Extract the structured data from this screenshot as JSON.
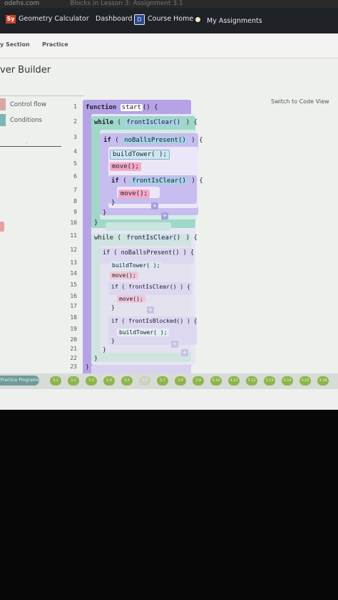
{
  "browser": {
    "domain": "odehs.com",
    "crumbs": "Blocks in Lesson 3: Assignment 3.1"
  },
  "header": {
    "brand_logo": "Sy",
    "brand": "Geometry Calculator",
    "nav": [
      "Dashboard",
      "Course Home",
      "My Assignments"
    ],
    "course_icon": "D"
  },
  "subnav": {
    "tabs": [
      "y Section",
      "Practice"
    ]
  },
  "page": {
    "title": "ver Builder",
    "switch_view": "Switch to Code View"
  },
  "palette": {
    "categories": [
      {
        "label": "Control flow",
        "color": "#d8a6a6"
      },
      {
        "label": "Conditions",
        "color": "#7fb6b4"
      }
    ],
    "dot": "."
  },
  "code": {
    "line_numbers": [
      "1",
      "2",
      "3",
      "4",
      "5",
      "6",
      "7",
      "8",
      "9",
      "10",
      "11",
      "12",
      "13",
      "14",
      "15",
      "16",
      "17",
      "18",
      "19",
      "20",
      "21",
      "22",
      "23"
    ],
    "function_kw": "function",
    "function_name": "start",
    "function_open": "() {",
    "while_kw": "while",
    "if_kw": "if",
    "open_paren": "(",
    "close_brace_open": ") {",
    "close_brace": "}",
    "frontIsClear": "frontIsClear()",
    "noBallsPresent": "noBallsPresent()",
    "frontIsBlocked": "frontIsBlocked()",
    "buildTower": "buildTower( );",
    "move": "move();",
    "plus": "+"
  },
  "footer": {
    "lesson_label": "Practice Programs",
    "lessons": [
      "3.1",
      "3.2",
      "3.3",
      "3.4",
      "3.5",
      "3.6",
      "3.7",
      "3.8",
      "3.9",
      "3.10",
      "3.11",
      "3.12",
      "3.13",
      "3.14",
      "3.15",
      "3.16"
    ]
  },
  "colors": {
    "function": "#b5a3e6",
    "while": "#9fd7c9",
    "if": "#c7bdee",
    "call": "#cfe6f2",
    "move": "#f4a9c7",
    "condition": "#a7d1e6"
  }
}
